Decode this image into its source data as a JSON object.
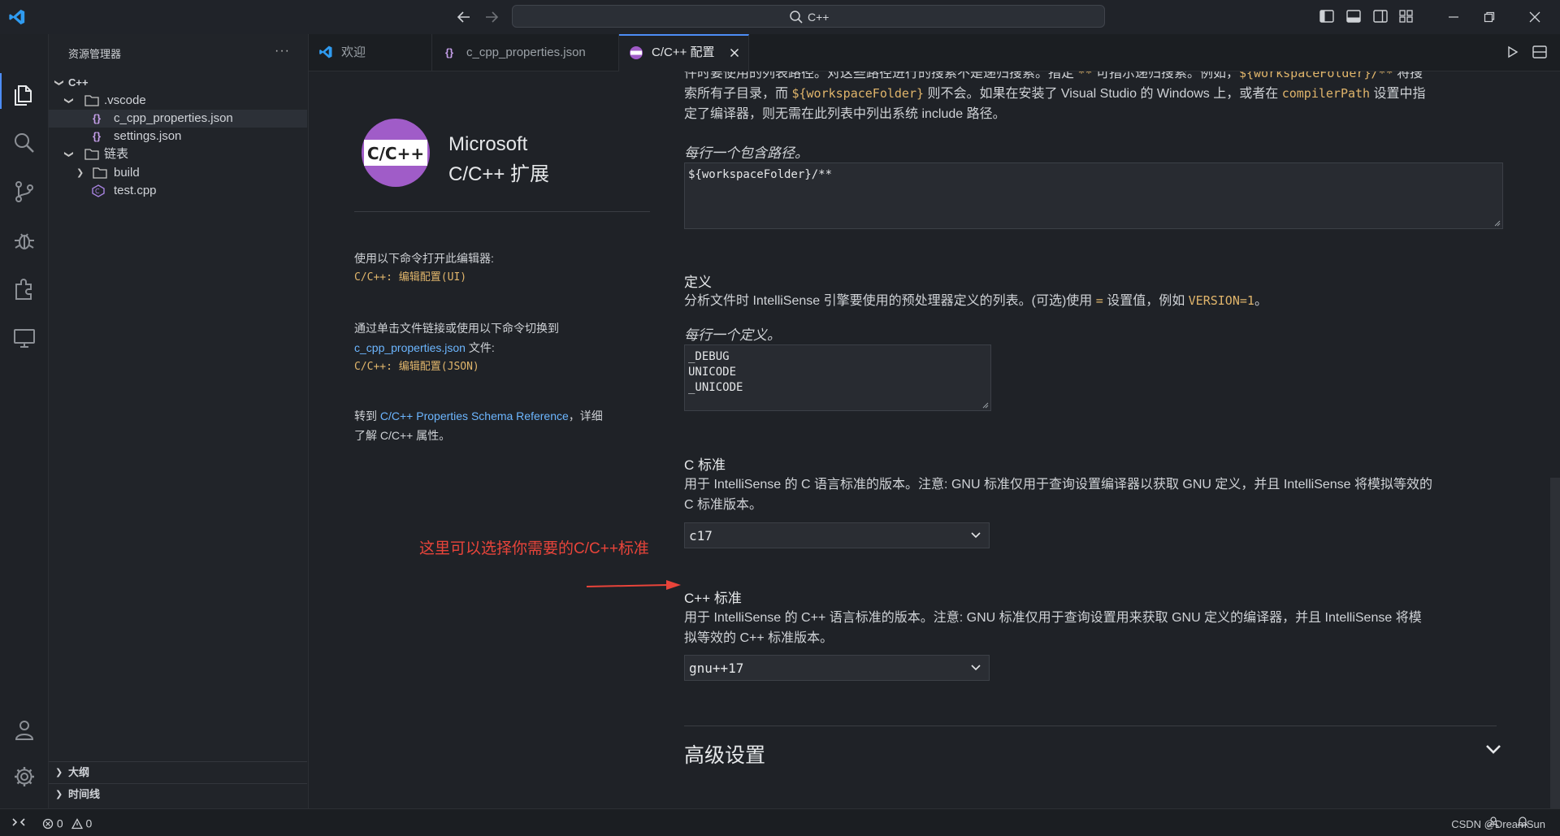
{
  "titlebar": {
    "search_text": "C++"
  },
  "sidebar": {
    "title": "资源管理器",
    "more": "···",
    "tree": [
      {
        "label": "C++"
      },
      {
        "label": ".vscode"
      },
      {
        "label": "c_cpp_properties.json"
      },
      {
        "label": "settings.json"
      },
      {
        "label": "链表"
      },
      {
        "label": "build"
      },
      {
        "label": "test.cpp"
      }
    ],
    "outline": "大纲",
    "timeline": "时间线"
  },
  "tabs": [
    {
      "label": "欢迎"
    },
    {
      "label": "c_cpp_properties.json"
    },
    {
      "label": "C/C++ 配置"
    }
  ],
  "left_pane": {
    "logo_text": "C/C++",
    "ext_name_line1": "Microsoft",
    "ext_name_line2": "C/C++ 扩展",
    "open_cmd_text": "使用以下命令打开此编辑器:",
    "open_cmd": "C/C++: 编辑配置(UI)",
    "switch_text1": "通过单击文件链接或使用以下命令切换到",
    "switch_link": "c_cpp_properties.json",
    "switch_text2": " 文件:",
    "switch_cmd": "C/C++: 编辑配置(JSON)",
    "schema_pre": "转到 ",
    "schema_link": "C/C++ Properties Schema Reference",
    "schema_post": "，详细",
    "schema_line2": "了解 C/C++ 属性。",
    "annotation": "这里可以选择你需要的C/C++标准"
  },
  "include": {
    "line1_a": "件时要使用的列表路径。对这些路径进行的搜索不是递归搜索。指定 ",
    "line1_code": "**",
    "line1_b": " 可指示递归搜索。例如，",
    "line1_code2": "${workspaceFolder}/**",
    "line1_c": " 将搜",
    "line2_a": "索所有子目录，而 ",
    "line2_code": "${workspaceFolder}",
    "line2_b": " 则不会。如果在安装了 Visual Studio 的 Windows 上，或者在 ",
    "line2_code2": "compilerPath",
    "line2_c": " 设置中指",
    "line3": "定了编译器，则无需在此列表中列出系统 include 路径。",
    "hint": "每行一个包含路径。",
    "value": "${workspaceFolder}/**"
  },
  "defines": {
    "title": "定义",
    "desc_a": "分析文件时 IntelliSense 引擎要使用的预处理器定义的列表。(可选)使用 ",
    "desc_code": "=",
    "desc_b": " 设置值，例如 ",
    "desc_code2": "VERSION=1",
    "desc_c": "。",
    "hint": "每行一个定义。",
    "value": "_DEBUG\nUNICODE\n_UNICODE"
  },
  "c_standard": {
    "title": "C 标准",
    "desc1": "用于 IntelliSense 的 C 语言标准的版本。注意: GNU 标准仅用于查询设置编译器以获取 GNU 定义，并且 IntelliSense 将模拟等效的",
    "desc2": "C 标准版本。",
    "value": "c17"
  },
  "cpp_standard": {
    "title": "C++ 标准",
    "desc1": "用于 IntelliSense 的 C++ 语言标准的版本。注意: GNU 标准仅用于查询设置用来获取 GNU 定义的编译器，并且 IntelliSense 将模",
    "desc2": "拟等效的 C++ 标准版本。",
    "value": "gnu++17"
  },
  "advanced": {
    "title": "高级设置"
  },
  "status": {
    "errors": "0",
    "warnings": "0",
    "watermark": "CSDN @DreamSun"
  },
  "colors": {
    "accent": "#4d8df6",
    "code": "#e0b56b",
    "link": "#6cb6ff",
    "annotation": "#e8443a"
  }
}
